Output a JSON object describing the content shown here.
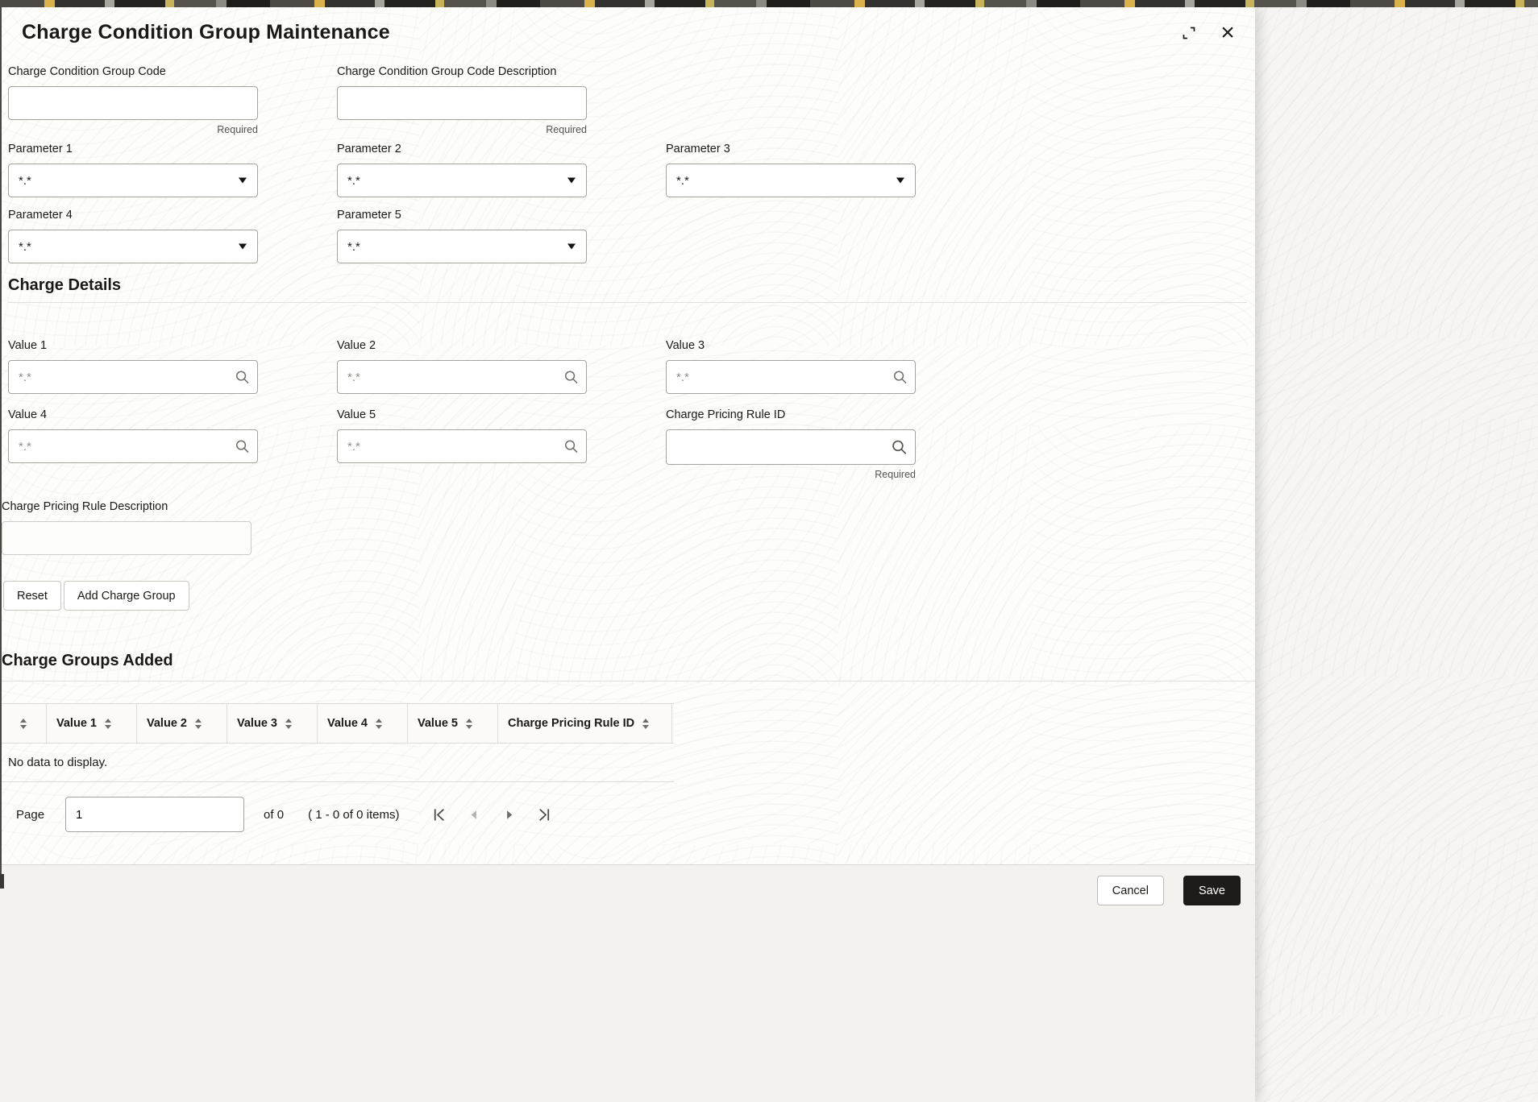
{
  "header": {
    "title": "Charge Condition Group Maintenance"
  },
  "icons": {
    "close_glyph": "×",
    "names": [
      "resize-icon",
      "close-icon",
      "chevron-down-icon",
      "search-icon",
      "sort-icon",
      "first-page-icon",
      "previous-page-icon",
      "next-page-icon",
      "last-page-icon"
    ]
  },
  "form": {
    "group_code_label": "Charge Condition Group Code",
    "group_desc_label": "Charge Condition Group Code Description",
    "required_hint": "Required",
    "parameters": [
      {
        "label": "Parameter 1",
        "value": "*.*"
      },
      {
        "label": "Parameter 2",
        "value": "*.*"
      },
      {
        "label": "Parameter 3",
        "value": "*.*"
      },
      {
        "label": "Parameter 4",
        "value": "*.*"
      },
      {
        "label": "Parameter 5",
        "value": "*.*"
      }
    ],
    "charge_details_heading": "Charge Details",
    "values": [
      {
        "label": "Value 1",
        "placeholder": "*.*"
      },
      {
        "label": "Value 2",
        "placeholder": "*.*"
      },
      {
        "label": "Value 3",
        "placeholder": "*.*"
      },
      {
        "label": "Value 4",
        "placeholder": "*.*"
      },
      {
        "label": "Value 5",
        "placeholder": "*.*"
      }
    ],
    "charge_pricing_rule_id_label": "Charge Pricing Rule ID",
    "charge_pricing_rule_desc_label": "Charge Pricing Rule Description",
    "reset_button": "Reset",
    "add_charge_group_button": "Add Charge Group"
  },
  "charge_groups": {
    "heading": "Charge Groups Added",
    "columns": [
      "Value 1",
      "Value 2",
      "Value 3",
      "Value 4",
      "Value 5",
      "Charge Pricing Rule ID"
    ],
    "empty_text": "No data to display.",
    "pagination": {
      "page_label": "Page",
      "page_value": "1",
      "of_text": "of 0",
      "items_text": "( 1 - 0 of 0 items)"
    }
  },
  "footer": {
    "cancel_button": "Cancel",
    "save_button": "Save"
  },
  "colors": {
    "accent_dark": "#1d1b19",
    "banner_yellow": "#d9b24b",
    "border": "#a5a39e"
  }
}
